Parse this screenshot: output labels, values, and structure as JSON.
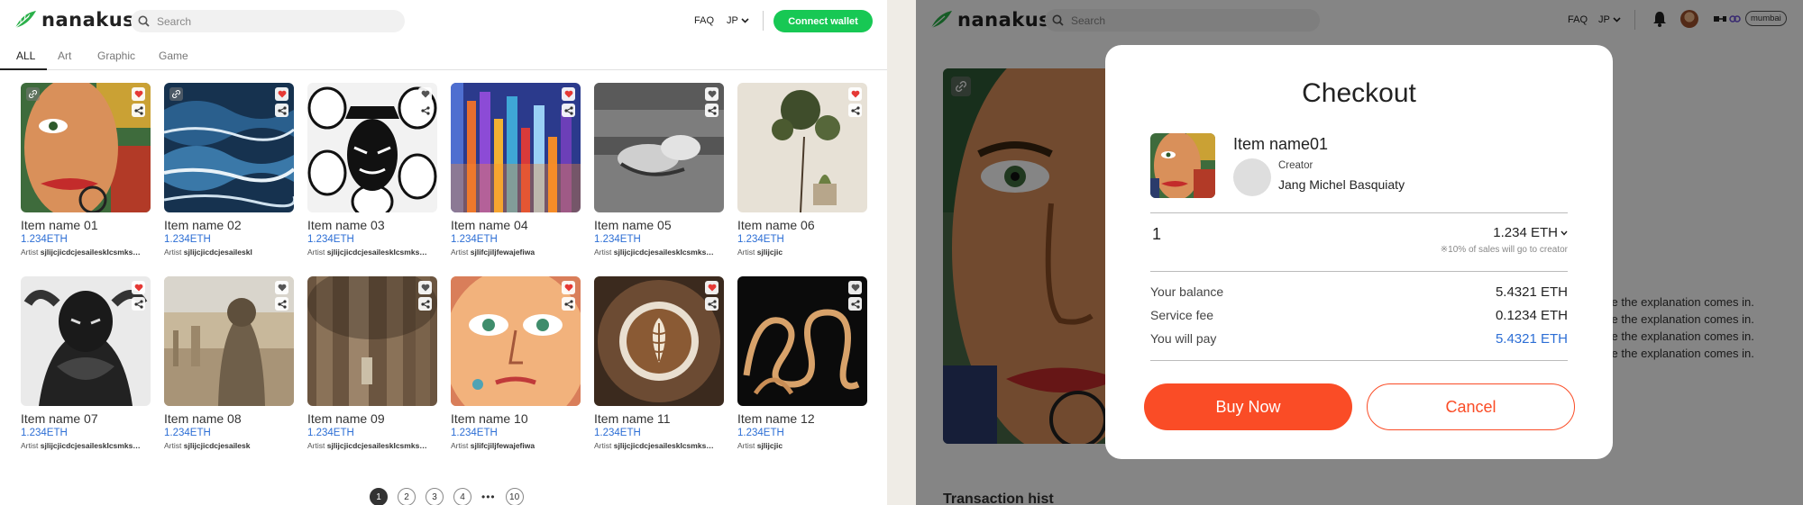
{
  "app": {
    "logo_text": "nanakusa"
  },
  "header": {
    "search_placeholder": "Search",
    "faq": "FAQ",
    "lang": "JP",
    "connect_wallet": "Connect wallet"
  },
  "tabs": [
    "ALL",
    "Art",
    "Graphic",
    "Game"
  ],
  "items": [
    {
      "name": "Item name 01",
      "price": "1.234ETH",
      "artist_label": "Artist",
      "artist": "sjlijcjicdcjesaileskIcsmks…",
      "liked": true,
      "has_link": true
    },
    {
      "name": "Item name 02",
      "price": "1.234ETH",
      "artist_label": "Artist",
      "artist": "sjlijcjicdcjesaileskl",
      "liked": true,
      "has_link": true
    },
    {
      "name": "Item name 03",
      "price": "1.234ETH",
      "artist_label": "Artist",
      "artist": "sjlijcjicdcjesaileskIcsmks…",
      "liked": false,
      "has_link": false
    },
    {
      "name": "Item name 04",
      "price": "1.234ETH",
      "artist_label": "Artist",
      "artist": "sjlifcjiljfewajefiwa",
      "liked": true,
      "has_link": false
    },
    {
      "name": "Item name 05",
      "price": "1.234ETH",
      "artist_label": "Artist",
      "artist": "sjlijcjicdcjesaileskIcsmks…",
      "liked": false,
      "has_link": false
    },
    {
      "name": "Item name 06",
      "price": "1.234ETH",
      "artist_label": "Artist",
      "artist": "sjlijcjic",
      "liked": true,
      "has_link": false
    },
    {
      "name": "Item name 07",
      "price": "1.234ETH",
      "artist_label": "Artist",
      "artist": "sjlijcjicdcjesaileskIcsmks…",
      "liked": true,
      "has_link": false
    },
    {
      "name": "Item name 08",
      "price": "1.234ETH",
      "artist_label": "Artist",
      "artist": "sjlijcjicdcjesailesk",
      "liked": false,
      "has_link": false
    },
    {
      "name": "Item name 09",
      "price": "1.234ETH",
      "artist_label": "Artist",
      "artist": "sjlijcjicdcjesaileskIcsmks…",
      "liked": false,
      "has_link": false
    },
    {
      "name": "Item name 10",
      "price": "1.234ETH",
      "artist_label": "Artist",
      "artist": "sjlifcjiljfewajefiwa",
      "liked": true,
      "has_link": false
    },
    {
      "name": "Item name 11",
      "price": "1.234ETH",
      "artist_label": "Artist",
      "artist": "sjlijcjicdcjesaileskIcsmks…",
      "liked": true,
      "has_link": false
    },
    {
      "name": "Item name 12",
      "price": "1.234ETH",
      "artist_label": "Artist",
      "artist": "sjlijcjic",
      "liked": false,
      "has_link": false
    }
  ],
  "pagination": {
    "pages": [
      "1",
      "2",
      "3",
      "4"
    ],
    "ellipsis": "•••",
    "last": "10",
    "current": "1"
  },
  "detail": {
    "network_badge": "mumbai",
    "explanation_lines": [
      "ere the explanation comes in.",
      "ere the explanation comes in.",
      "ere the explanation comes in.",
      "ere the explanation comes in."
    ],
    "section_heading": "Transaction hist"
  },
  "checkout": {
    "title": "Checkout",
    "item_name": "Item name01",
    "creator_label": "Creator",
    "creator_name": "Jang Michel Basquiaty",
    "quantity": "1",
    "price": "1.234 ETH",
    "royalty_note": "※10% of sales will go to creator",
    "balance_label": "Your balance",
    "balance_value": "5.4321 ETH",
    "fee_label": "Service fee",
    "fee_value": "0.1234 ETH",
    "pay_label": "You will pay",
    "pay_value": "5.4321 ETH",
    "buy_button": "Buy Now",
    "cancel_button": "Cancel"
  },
  "colors": {
    "brand_green": "#17c854",
    "accent_orange": "#fa4c26",
    "link_blue": "#2c6ed5",
    "like_red": "#e53935"
  }
}
